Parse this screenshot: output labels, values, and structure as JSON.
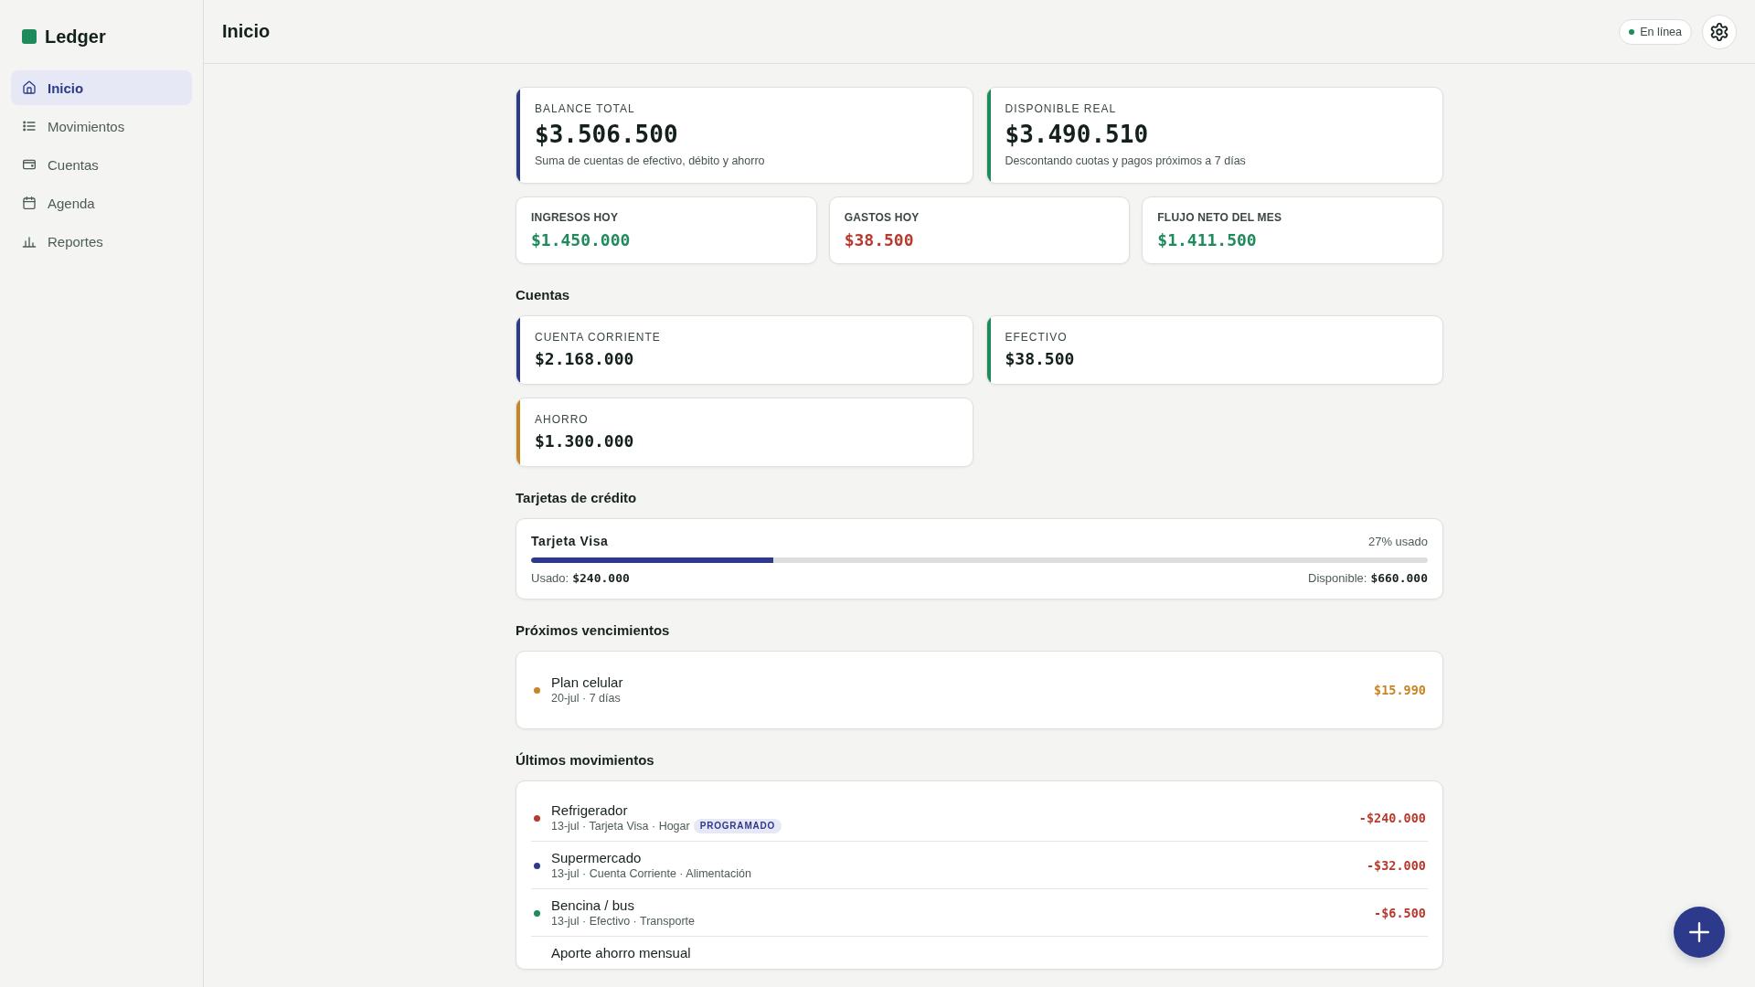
{
  "sidebar": {
    "brand": "Ledger",
    "nav": [
      {
        "label": "Inicio",
        "kind": "home",
        "selected": true
      },
      {
        "label": "Movimientos",
        "kind": "list",
        "selected": false
      },
      {
        "label": "Cuentas",
        "kind": "wallet",
        "selected": false
      },
      {
        "label": "Agenda",
        "kind": "calendar",
        "selected": false
      },
      {
        "label": "Reportes",
        "kind": "chart",
        "selected": false
      }
    ]
  },
  "header": {
    "title": "Inicio",
    "status": {
      "label": "En línea",
      "online": true
    }
  },
  "summary": [
    {
      "label": "BALANCE TOTAL",
      "value": "$3.506.500",
      "note": "Suma de cuentas de efectivo, débito y ahorro",
      "color": "#2d3a8c"
    },
    {
      "label": "DISPONIBLE REAL",
      "value": "$3.490.510",
      "note": "Descontando cuotas y pagos próximos a 7 días",
      "color": "#1f8a5b"
    }
  ],
  "stats": [
    {
      "label": "INGRESOS HOY",
      "value": "$1.450.000",
      "color": "#1f8a5b"
    },
    {
      "label": "GASTOS HOY",
      "value": "$38.500",
      "color": "#b83a2f"
    },
    {
      "label": "FLUJO NETO DEL MES",
      "value": "$1.411.500",
      "color": "#1f8a5b"
    }
  ],
  "accounts": {
    "title": "Cuentas",
    "items": [
      {
        "label": "CUENTA CORRIENTE",
        "value": "$2.168.000",
        "color": "#2d3a8c"
      },
      {
        "label": "EFECTIVO",
        "value": "$38.500",
        "color": "#1f8a5b"
      },
      {
        "label": "AHORRO",
        "value": "$1.300.000",
        "color": "#c98424"
      }
    ]
  },
  "credit_cards": {
    "title": "Tarjetas de crédito",
    "items": [
      {
        "name": "Tarjeta Visa",
        "usage": "27% usado",
        "level": 0.27,
        "used_label": "Usado:",
        "used": "$240.000",
        "available_label": "Disponible:",
        "available": "$660.000"
      }
    ]
  },
  "upcoming": {
    "title": "Próximos vencimientos",
    "items": [
      {
        "name": "Plan celular",
        "meta": "20-jul · 7 días",
        "amount": "$15.990",
        "color": "#c98424"
      }
    ]
  },
  "movements": {
    "title": "Últimos movimientos",
    "items": [
      {
        "name": "Refrigerador",
        "meta": "13-jul · Tarjeta Visa · Hogar",
        "tag": "PROGRAMADO",
        "amount": "-$240.000",
        "expense": true,
        "color": "#b83a2f"
      },
      {
        "name": "Supermercado",
        "meta": "13-jul · Cuenta Corriente · Alimentación",
        "amount": "-$32.000",
        "expense": true,
        "color": "#2d3a8c"
      },
      {
        "name": "Bencina / bus",
        "meta": "13-jul · Efectivo · Transporte",
        "amount": "-$6.500",
        "expense": true,
        "color": "#1f8a5b"
      },
      {
        "name": "Aporte ahorro mensual"
      }
    ]
  }
}
